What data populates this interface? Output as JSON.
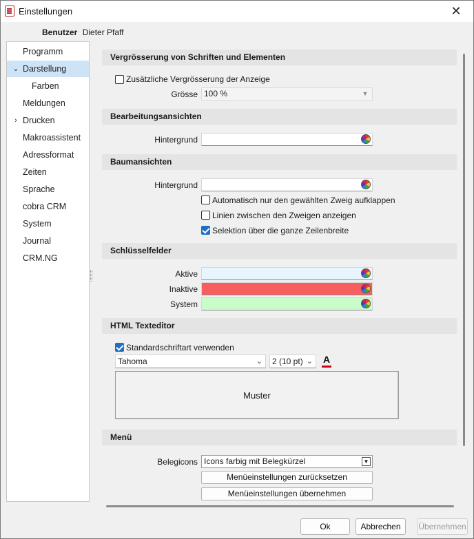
{
  "window": {
    "title": "Einstellungen"
  },
  "user": {
    "label": "Benutzer",
    "name": "Dieter Pfaff"
  },
  "sidebar": {
    "items": [
      {
        "label": "Programm"
      },
      {
        "label": "Darstellung"
      },
      {
        "label": "Farben"
      },
      {
        "label": "Meldungen"
      },
      {
        "label": "Drucken"
      },
      {
        "label": "Makroassistent"
      },
      {
        "label": "Adressformat"
      },
      {
        "label": "Zeiten"
      },
      {
        "label": "Sprache"
      },
      {
        "label": "cobra CRM"
      },
      {
        "label": "System"
      },
      {
        "label": "Journal"
      },
      {
        "label": "CRM.NG"
      }
    ]
  },
  "sections": {
    "scaling": {
      "title": "Vergrösserung von Schriften und Elementen",
      "extra_zoom_label": "Zusätzliche Vergrösserung der Anzeige",
      "extra_zoom_checked": false,
      "size_label": "Grösse",
      "size_value": "100 %"
    },
    "edit_views": {
      "title": "Bearbeitungsansichten",
      "background_label": "Hintergrund"
    },
    "tree_views": {
      "title": "Baumansichten",
      "background_label": "Hintergrund",
      "auto_expand_label": "Automatisch nur den gewählten Zweig aufklappen",
      "auto_expand_checked": false,
      "lines_label": "Linien zwischen den Zweigen anzeigen",
      "lines_checked": false,
      "full_row_label": "Selektion über die ganze Zeilenbreite",
      "full_row_checked": true
    },
    "key_fields": {
      "title": "Schlüsselfelder",
      "active_label": "Aktive",
      "inactive_label": "Inaktive",
      "system_label": "System",
      "active_color": "#e6f6fc",
      "inactive_color": "#f85e5e",
      "system_color": "#c8fcc8"
    },
    "html_editor": {
      "title": "HTML Texteditor",
      "std_font_label": "Standardschriftart verwenden",
      "std_font_checked": true,
      "font_name": "Tahoma",
      "font_size": "2  (10 pt)",
      "preview_text": "Muster"
    },
    "menu": {
      "title": "Menü",
      "belegicons_label": "Belegicons",
      "belegicons_value": "Icons farbig mit Belegkürzel",
      "reset_button": "Menüeinstellungen zurücksetzen",
      "apply_button": "Menüeinstellungen übernehmen"
    }
  },
  "footer": {
    "ok_label": "Ok",
    "cancel_label": "Abbrechen",
    "apply_label": "Übernehmen"
  }
}
